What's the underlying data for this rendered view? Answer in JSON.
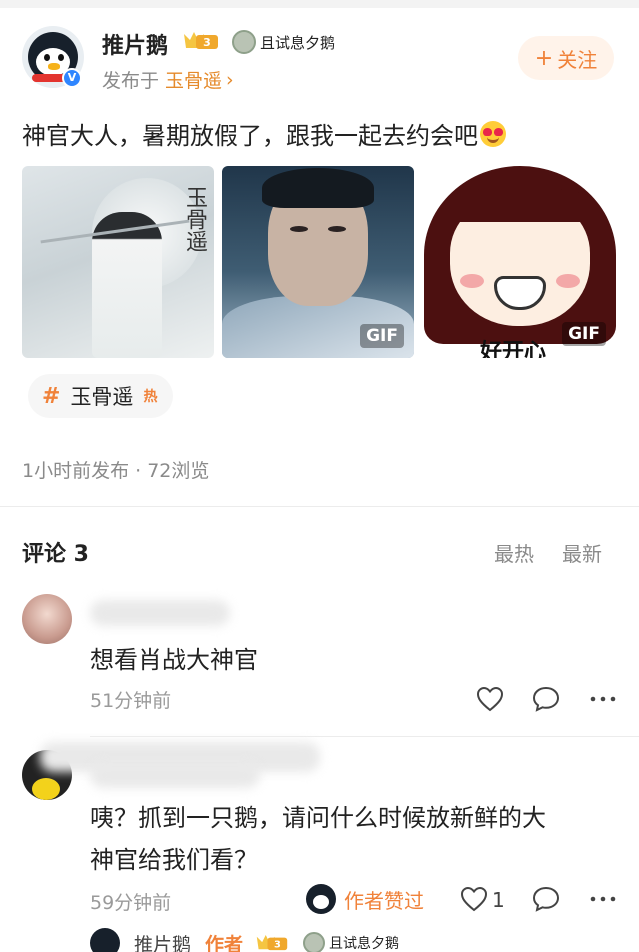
{
  "post": {
    "username": "推片鹅",
    "vip_level": "3",
    "fan_badge": "且试息夕鹅",
    "posted_prefix": "发布于",
    "posted_topic": "玉骨遥",
    "follow_label": "关注",
    "text": "神官大人，暑期放假了，跟我一起去约会吧",
    "images": [
      {
        "calligraphy": "玉骨遥",
        "gif": ""
      },
      {
        "gif": "GIF"
      },
      {
        "gif": "GIF",
        "caption": "好开心"
      }
    ],
    "topic_chip": {
      "label": "玉骨遥",
      "hot": "热"
    },
    "meta": "1小时前发布 · 72浏览"
  },
  "comments_section": {
    "title": "评论 3",
    "sort_hot": "最热",
    "sort_new": "最新"
  },
  "comments": [
    {
      "text": "想看肖战大神官",
      "time": "51分钟前"
    },
    {
      "text_line1": "咦？抓到一只鹅，请问什么时候放新鲜的大",
      "text_line2": "神官给我们看？",
      "time": "59分钟前",
      "author_liked": "作者赞过",
      "like_count": "1"
    }
  ],
  "reply_preview": {
    "name": "推片鹅",
    "author_tag": "作者",
    "vip_level": "3",
    "fan_badge": "且试息夕鹅"
  },
  "colors": {
    "accent": "#f0823a",
    "link": "#e58a2b",
    "verify": "#2f86ff"
  }
}
